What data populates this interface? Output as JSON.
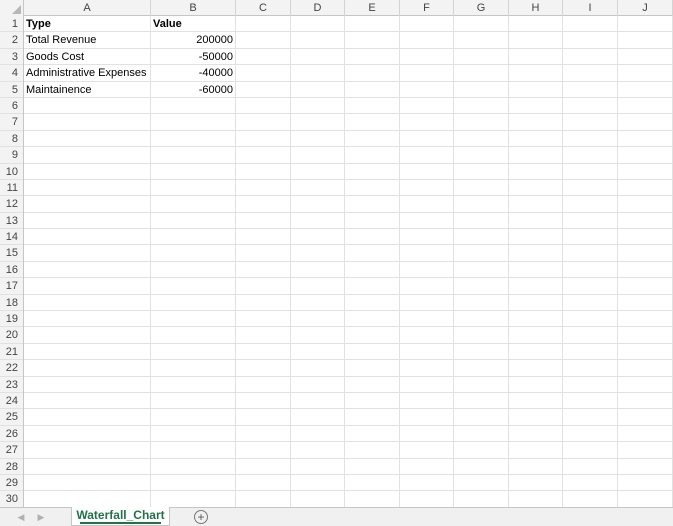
{
  "columns": [
    "A",
    "B",
    "C",
    "D",
    "E",
    "F",
    "G",
    "H",
    "I",
    "J"
  ],
  "rows": [
    "1",
    "2",
    "3",
    "4",
    "5",
    "6",
    "7",
    "8",
    "9",
    "10",
    "11",
    "12",
    "13",
    "14",
    "15",
    "16",
    "17",
    "18",
    "19",
    "20",
    "21",
    "22",
    "23",
    "24",
    "25",
    "26",
    "27",
    "28",
    "29",
    "30"
  ],
  "cells": {
    "A1": "Type",
    "B1": "Value",
    "A2": "Total Revenue",
    "B2": "200000",
    "A3": "Goods Cost",
    "B3": "-50000",
    "A4": "Administrative Expenses",
    "B4": "-40000",
    "A5": "Maintainence",
    "B5": "-60000"
  },
  "sheet_tabs": {
    "active": "Waterfall_Chart",
    "add_icon": "+",
    "prev_icon": "◀",
    "next_icon": "▶"
  }
}
